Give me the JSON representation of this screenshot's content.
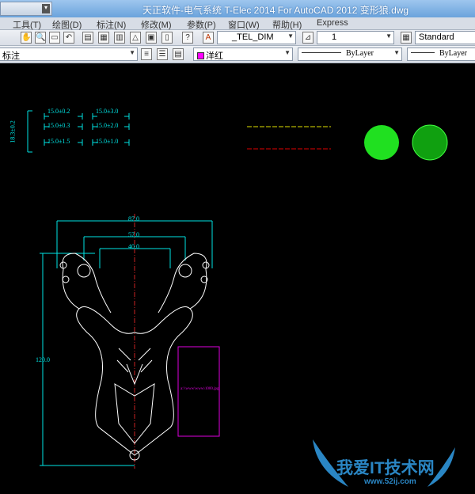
{
  "title": "天正软件-电气系统 T-Elec 2014  For AutoCAD 2012    变形狼.dwg",
  "menu": [
    "工具(T)",
    "绘图(D)",
    "标注(N)",
    "修改(M)",
    "参数(P)",
    "窗口(W)",
    "帮助(H)",
    "Express"
  ],
  "toolbar": {
    "dimstyle": "_TEL_DIM",
    "scale": "1",
    "tablestyle": "Standard"
  },
  "properties": {
    "layer": "标注",
    "color": "洋红",
    "linetype": "ByLayer",
    "lineweight": "ByLayer"
  },
  "drawing": {
    "tolerances": [
      "15.0±0.2",
      "15.0±3.0",
      "15.0±0.3",
      "15.0±2.0",
      "15.0±1.5",
      "15.0±1.0"
    ],
    "vertical_tolerance": "18.3±0.2",
    "dims": {
      "overall_width": "87.0",
      "mid_width": "57.0",
      "inner_width": "40.0",
      "height": "120.0"
    },
    "box_text": "a:\\\\www\\www\\1000.jpg"
  },
  "watermark": {
    "name": "我爱IT技术网",
    "url": "www.52ij.com"
  }
}
